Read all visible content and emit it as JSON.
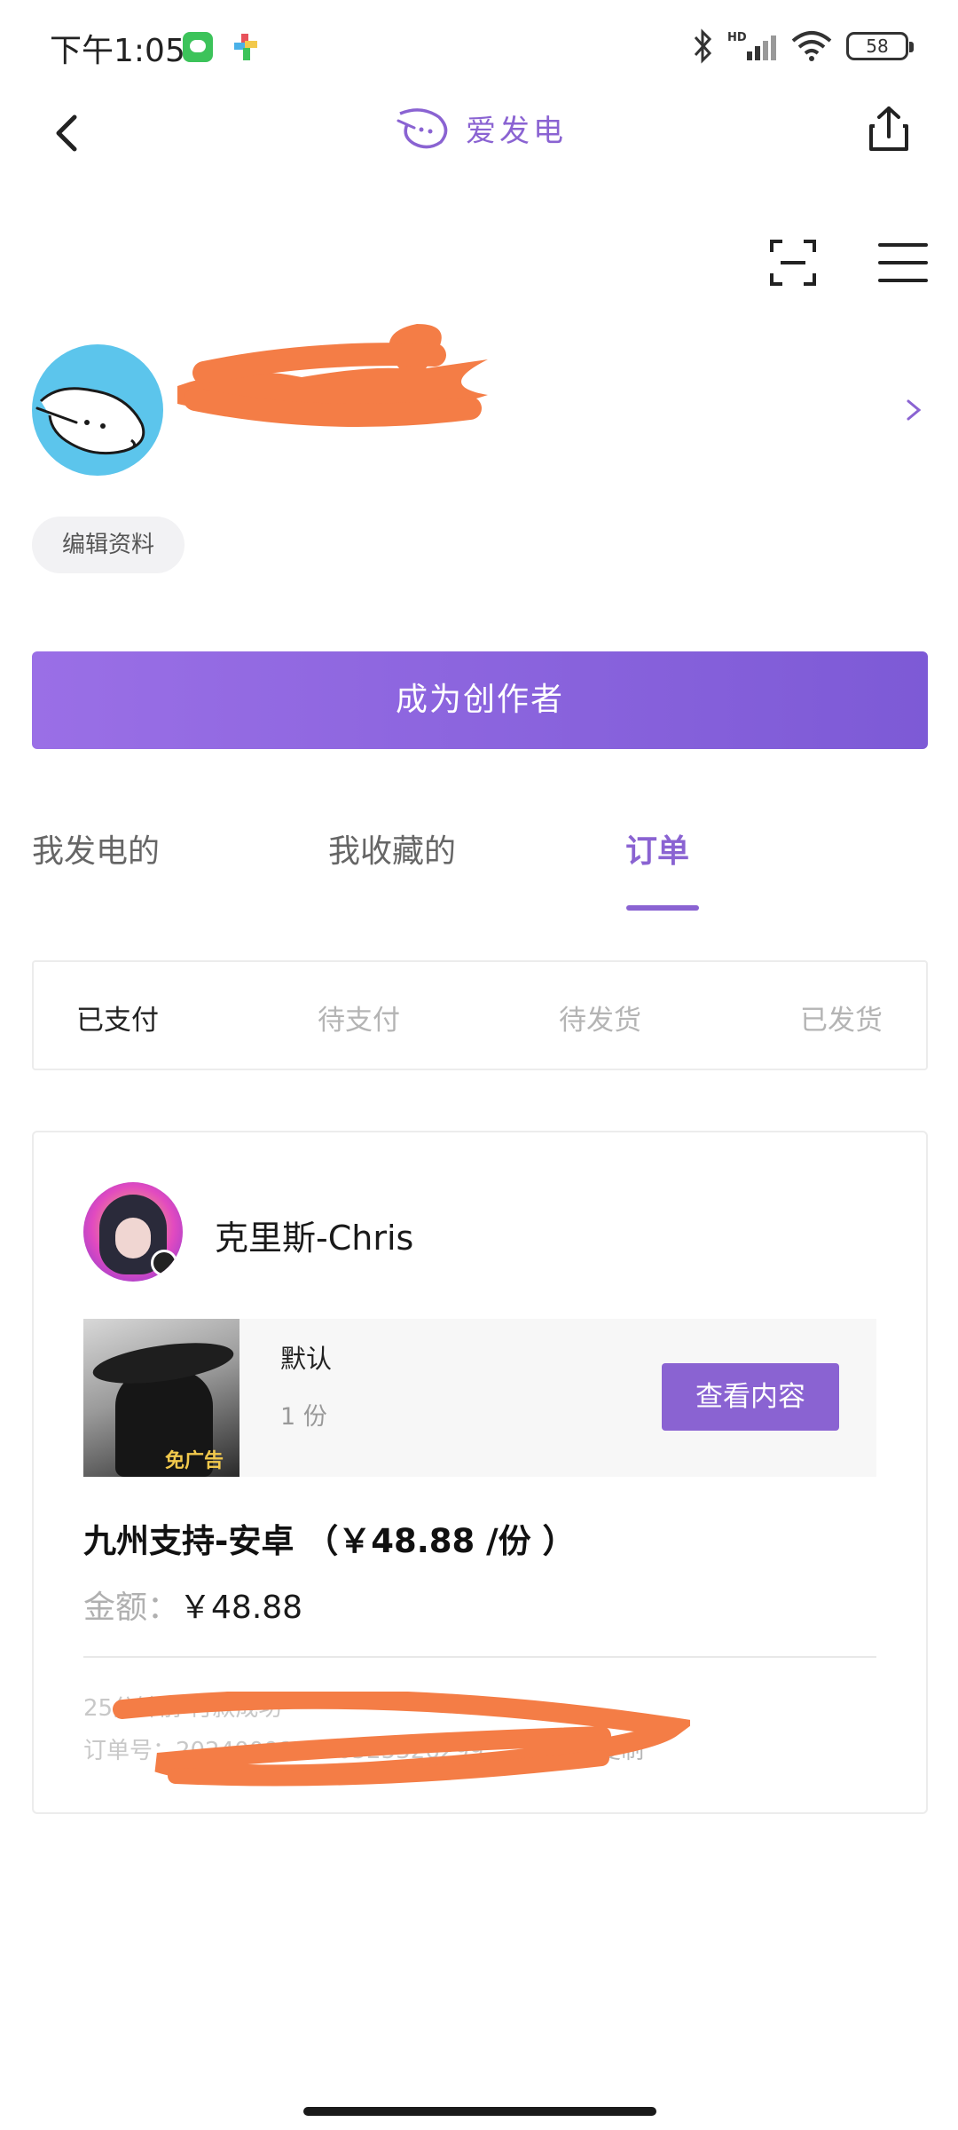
{
  "status_bar": {
    "time": "下午1:05",
    "battery": "58"
  },
  "header": {
    "brand": "爱发电"
  },
  "profile": {
    "edit_label": "编辑资料"
  },
  "creator_button": "成为创作者",
  "tabs": [
    {
      "label": "我发电的"
    },
    {
      "label": "我收藏的"
    },
    {
      "label": "订单"
    }
  ],
  "subtabs": [
    {
      "label": "已支付"
    },
    {
      "label": "待支付"
    },
    {
      "label": "待发货"
    },
    {
      "label": "已发货"
    }
  ],
  "order": {
    "creator_name": "克里斯-Chris",
    "variant": "默认",
    "quantity": "1 份",
    "view_button": "查看内容",
    "thumbnail_text": "免广告",
    "title": "九州支持-安卓 （￥48.88 /份 ）",
    "amount_label": "金额：",
    "amount_value": "￥48.88",
    "pay_status": "25分钟前 付款成功",
    "order_number_label": "订单号：",
    "order_number": "202400085650525326299",
    "copy_label": "复制"
  },
  "colors": {
    "accent": "#8a63d2",
    "redaction": "#f47d46"
  }
}
